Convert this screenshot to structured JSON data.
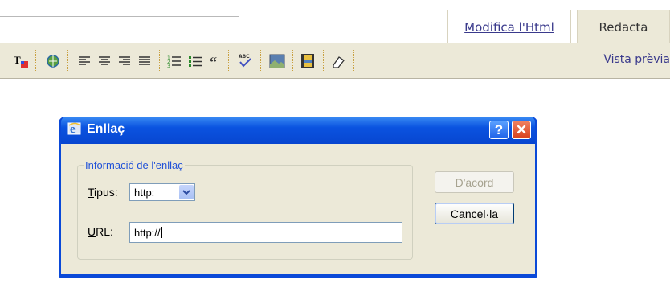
{
  "tabs": {
    "html_label": "Modifica l'Html",
    "edit_label": "Redacta"
  },
  "toolbar": {
    "items": [
      "font-color-icon",
      "link-icon",
      "align-left-icon",
      "align-center-icon",
      "align-right-icon",
      "justify-icon",
      "numbered-list-icon",
      "bullet-list-icon",
      "blockquote-icon",
      "spellcheck-icon",
      "image-icon",
      "video-icon",
      "eraser-icon"
    ],
    "preview_label": "Vista prèvia"
  },
  "dialog": {
    "title": "Enllaç",
    "help_label": "?",
    "close_label": "✕",
    "group_label": "Informació de l'enllaç",
    "type_label_first": "T",
    "type_label_rest": "ipus:",
    "type_value": "http:",
    "url_label_first": "U",
    "url_label_rest": "RL:",
    "url_value": "http://",
    "ok_label": "D'acord",
    "cancel_label": "Cancel·la"
  },
  "colors": {
    "titlebar": "#0a53e0",
    "dialog_bg": "#ece9d8",
    "toolbar_bg": "#ece9d8",
    "link": "#3a3a8c"
  }
}
